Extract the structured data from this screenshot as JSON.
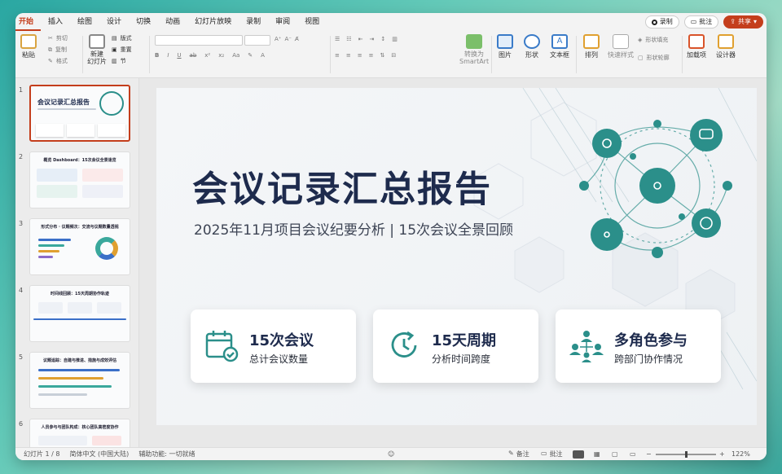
{
  "tabs": [
    "开始",
    "插入",
    "绘图",
    "设计",
    "切换",
    "动画",
    "幻灯片放映",
    "录制",
    "审阅",
    "视图"
  ],
  "top_right": {
    "record": "录制",
    "comments": "批注",
    "share": "共享"
  },
  "ribbon": {
    "paste": "粘贴",
    "cut": "剪切",
    "copy": "复制",
    "format": "格式",
    "new_slide": "新建\n幻灯片",
    "layout": "版式",
    "reset": "重置",
    "section": "节",
    "smartart": "转换为\nSmartArt",
    "picture": "图片",
    "shape": "形状",
    "textbox": "文本框",
    "arrange": "排列",
    "quick_styles": "快速样式",
    "shape_fill": "形状填充",
    "shape_outline": "形状轮廓",
    "addins": "加载项",
    "designer": "设计器"
  },
  "thumbnails": [
    {
      "num": "1",
      "title": "会议记录汇总报告"
    },
    {
      "num": "2",
      "title": "概览 Dashboard：15次会议全景速览"
    },
    {
      "num": "3",
      "title": "形式分布 · 议题频次：交流与议题数量透视"
    },
    {
      "num": "4",
      "title": "时间线回顾：15天周期协作轨迹"
    },
    {
      "num": "5",
      "title": "议题追踪：自建与推进、措施与成效评估"
    },
    {
      "num": "6",
      "title": "人员参与与团队构成：核心团队高密度协作"
    }
  ],
  "slide": {
    "title": "会议记录汇总报告",
    "subtitle": "2025年11月项目会议纪要分析 | 15次会议全景回顾",
    "cards": [
      {
        "headline": "15次会议",
        "sub": "总计会议数量",
        "icon": "calendar-check-icon"
      },
      {
        "headline": "15天周期",
        "sub": "分析时间跨度",
        "icon": "clock-arrow-icon"
      },
      {
        "headline": "多角色参与",
        "sub": "跨部门协作情况",
        "icon": "team-network-icon"
      }
    ]
  },
  "status": {
    "slide_counter": "幻灯片 1 / 8",
    "language": "简体中文 (中国大陆)",
    "accessibility": "辅助功能: 一切就绪",
    "notes": "备注",
    "comments": "批注",
    "zoom": "122%"
  },
  "colors": {
    "accent": "#c43e1c",
    "teal": "#2b8f8a",
    "navy": "#1e2b4d"
  }
}
